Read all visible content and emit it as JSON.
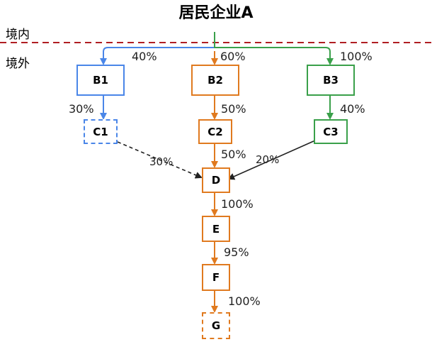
{
  "title": "居民企业A",
  "regions": {
    "domestic": "境内",
    "overseas": "境外"
  },
  "colors": {
    "blue": "#4a86e8",
    "orange": "#e07a1f",
    "green": "#3aa04a",
    "divider": "#b01e23",
    "black": "#222222"
  },
  "nodes": {
    "b1": "B1",
    "b2": "B2",
    "b3": "B3",
    "c1": "C1",
    "c2": "C2",
    "c3": "C3",
    "d": "D",
    "e": "E",
    "f": "F",
    "g": "G"
  },
  "percentages": {
    "a_b1": "40%",
    "a_b2": "60%",
    "a_b3": "100%",
    "b1_c1": "30%",
    "b2_c2": "50%",
    "b3_c3": "40%",
    "c1_d": "30%",
    "c2_d": "50%",
    "c3_d": "20%",
    "d_e": "100%",
    "e_f": "95%",
    "f_g": "100%"
  }
}
